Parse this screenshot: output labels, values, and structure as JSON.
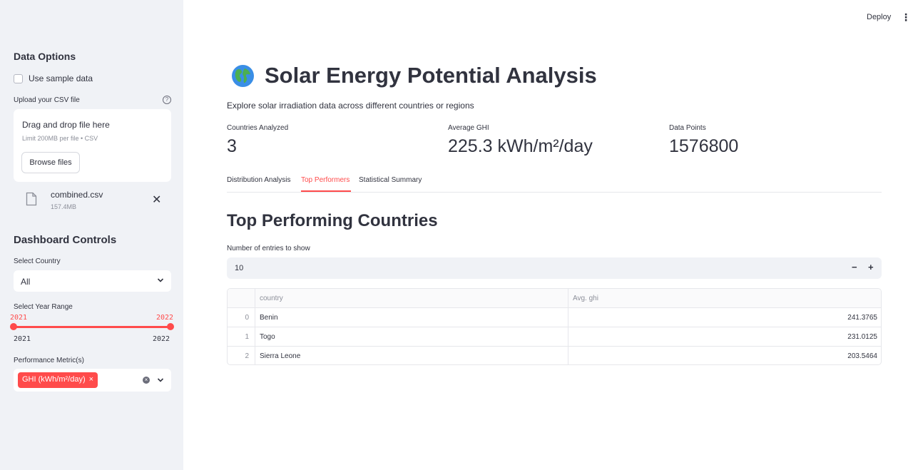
{
  "sidebar": {
    "data_options_title": "Data Options",
    "use_sample_label": "Use sample data",
    "upload_label": "Upload your CSV file",
    "help_glyph": "?",
    "dropzone_title": "Drag and drop file here",
    "dropzone_limit": "Limit 200MB per file • CSV",
    "browse_label": "Browse files",
    "file": {
      "name": "combined.csv",
      "size": "157.4MB",
      "remove_glyph": "✕"
    },
    "dashboard_title": "Dashboard Controls",
    "country_label": "Select Country",
    "country_value": "All",
    "year_label": "Select Year Range",
    "year_low": "2021",
    "year_high": "2022",
    "year_min": "2021",
    "year_max": "2022",
    "metric_label": "Performance Metric(s)",
    "metric_chip": "GHI (kWh/m²/day)",
    "chip_remove_glyph": "×",
    "clear_glyph": "×"
  },
  "header": {
    "deploy_label": "Deploy",
    "menu_glyph": "⋮"
  },
  "main": {
    "title": "Solar Energy Potential Analysis",
    "subtitle": "Explore solar irradiation data across different countries or regions",
    "metrics": [
      {
        "label": "Countries Analyzed",
        "value": "3"
      },
      {
        "label": "Average GHI",
        "value": "225.3 kWh/m²/day"
      },
      {
        "label": "Data Points",
        "value": "1576800"
      }
    ],
    "tabs": [
      "Distribution Analysis",
      "Top Performers",
      "Statistical Summary"
    ],
    "active_tab": "Top Performers",
    "section_title": "Top Performing Countries",
    "entries_label": "Number of entries to show",
    "entries_value": "10",
    "minus_glyph": "−",
    "plus_glyph": "+",
    "table": {
      "headers": [
        "country",
        "Avg. ghi"
      ],
      "rows": [
        {
          "index": "0",
          "country": "Benin",
          "ghi": "241.3765"
        },
        {
          "index": "1",
          "country": "Togo",
          "ghi": "231.0125"
        },
        {
          "index": "2",
          "country": "Sierra Leone",
          "ghi": "203.5464"
        }
      ]
    }
  },
  "colors": {
    "accent": "#ff4b4b",
    "sidebar_bg": "#f0f2f6",
    "text": "#31333f"
  },
  "icons": [
    "globe-icon",
    "help-icon",
    "file-icon",
    "close-icon",
    "chevron-down-icon",
    "clear-icon",
    "kebab-menu-icon"
  ]
}
